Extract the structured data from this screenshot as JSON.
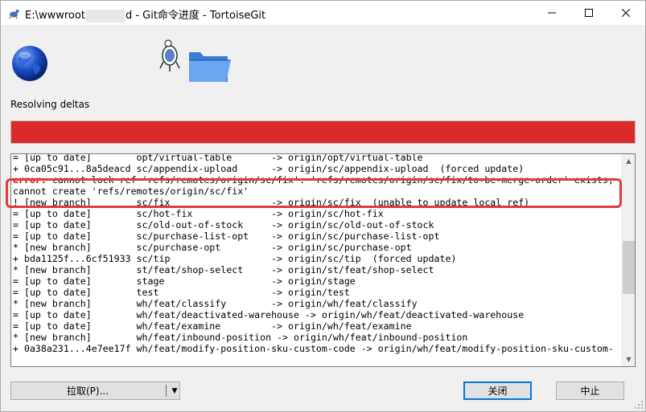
{
  "window": {
    "title_prefix": "E:\\wwwroot",
    "title_suffix": "d - Git命令进度 - TortoiseGit"
  },
  "status": {
    "label": "Resolving deltas",
    "progress_percent": 100,
    "bar_color": "#dc2a2a"
  },
  "log": {
    "lines": [
      "= [up to date]        opt/virtual-table       -> origin/opt/virtual-table",
      "+ 0ca05c91...8a5deacd sc/appendix-upload      -> origin/sc/appendix-upload  (forced update)",
      "",
      "",
      "! [new branch]        sc/fix                  -> origin/sc/fix  (unable to update local ref)",
      "= [up to date]        sc/hot-fix              -> origin/sc/hot-fix",
      "= [up to date]        sc/old-out-of-stock     -> origin/sc/old-out-of-stock",
      "= [up to date]        sc/purchase-list-opt    -> origin/sc/purchase-list-opt",
      "* [new branch]        sc/purchase-opt         -> origin/sc/purchase-opt",
      "+ bda1125f...6cf51933 sc/tip                  -> origin/sc/tip  (forced update)",
      "* [new branch]        st/feat/shop-select     -> origin/st/feat/shop-select",
      "= [up to date]        stage                   -> origin/stage",
      "= [up to date]        test                    -> origin/test",
      "* [new branch]        wh/feat/classify        -> origin/wh/feat/classify",
      "= [up to date]        wh/feat/deactivated-warehouse -> origin/wh/feat/deactivated-warehouse",
      "= [up to date]        wh/feat/examine         -> origin/wh/feat/examine",
      "* [new branch]        wh/feat/inbound-position -> origin/wh/feat/inbound-position",
      "+ 0a38a231...4e7ee17f wh/feat/modify-position-sku-custom-code -> origin/wh/feat/modify-position-sku-custom-"
    ],
    "error_prefix": "error:",
    "error_line_1": " cannot lock ref 'refs/remotes/origin/sc/fix': 'refs/remotes/origin/sc/fix/to-be-merge-order' exists;",
    "error_line_2": "cannot create 'refs/remotes/origin/sc/fix'"
  },
  "buttons": {
    "pull": "拉取(P)...",
    "close": "关闭",
    "cancel": "中止"
  },
  "colors": {
    "error_text": "#cc0000",
    "highlight": "#e23b3b",
    "primary_border": "#0078d7"
  }
}
